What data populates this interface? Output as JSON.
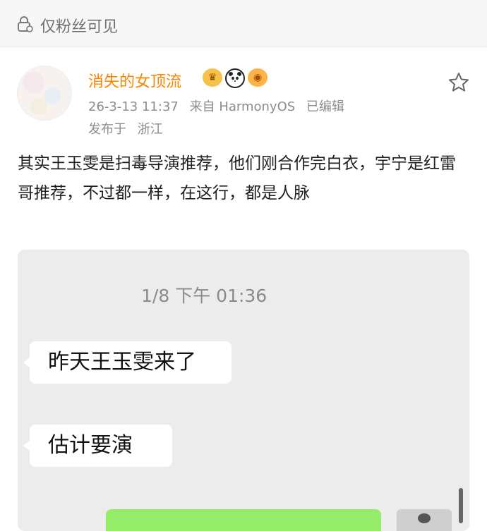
{
  "visibility": {
    "label": "仅粉丝可见",
    "icon": "lock-icon"
  },
  "post": {
    "username": "消失的女顶流",
    "badges": [
      "crown-badge-icon",
      "panda-badge-icon",
      "fish-badge-icon"
    ],
    "datetime": "26-3-13 11:37",
    "source": "来自 HarmonyOS",
    "edited": "已编辑",
    "published_from": "发布于",
    "location": "浙江",
    "text": "其实王玉雯是扫毒导演推荐，他们刚合作完白衣，宇宁是红雷哥推荐，不过都一样，在这行，都是人脉"
  },
  "chat_screenshot": {
    "timestamp": "1/8 下午 01:36",
    "messages": [
      "昨天王玉雯来了",
      "估计要演"
    ]
  },
  "colors": {
    "username": "#ff8200",
    "meta": "#8c8c8c",
    "chat_bg": "#ececec",
    "chat_bubble_self": "#95ec69"
  }
}
